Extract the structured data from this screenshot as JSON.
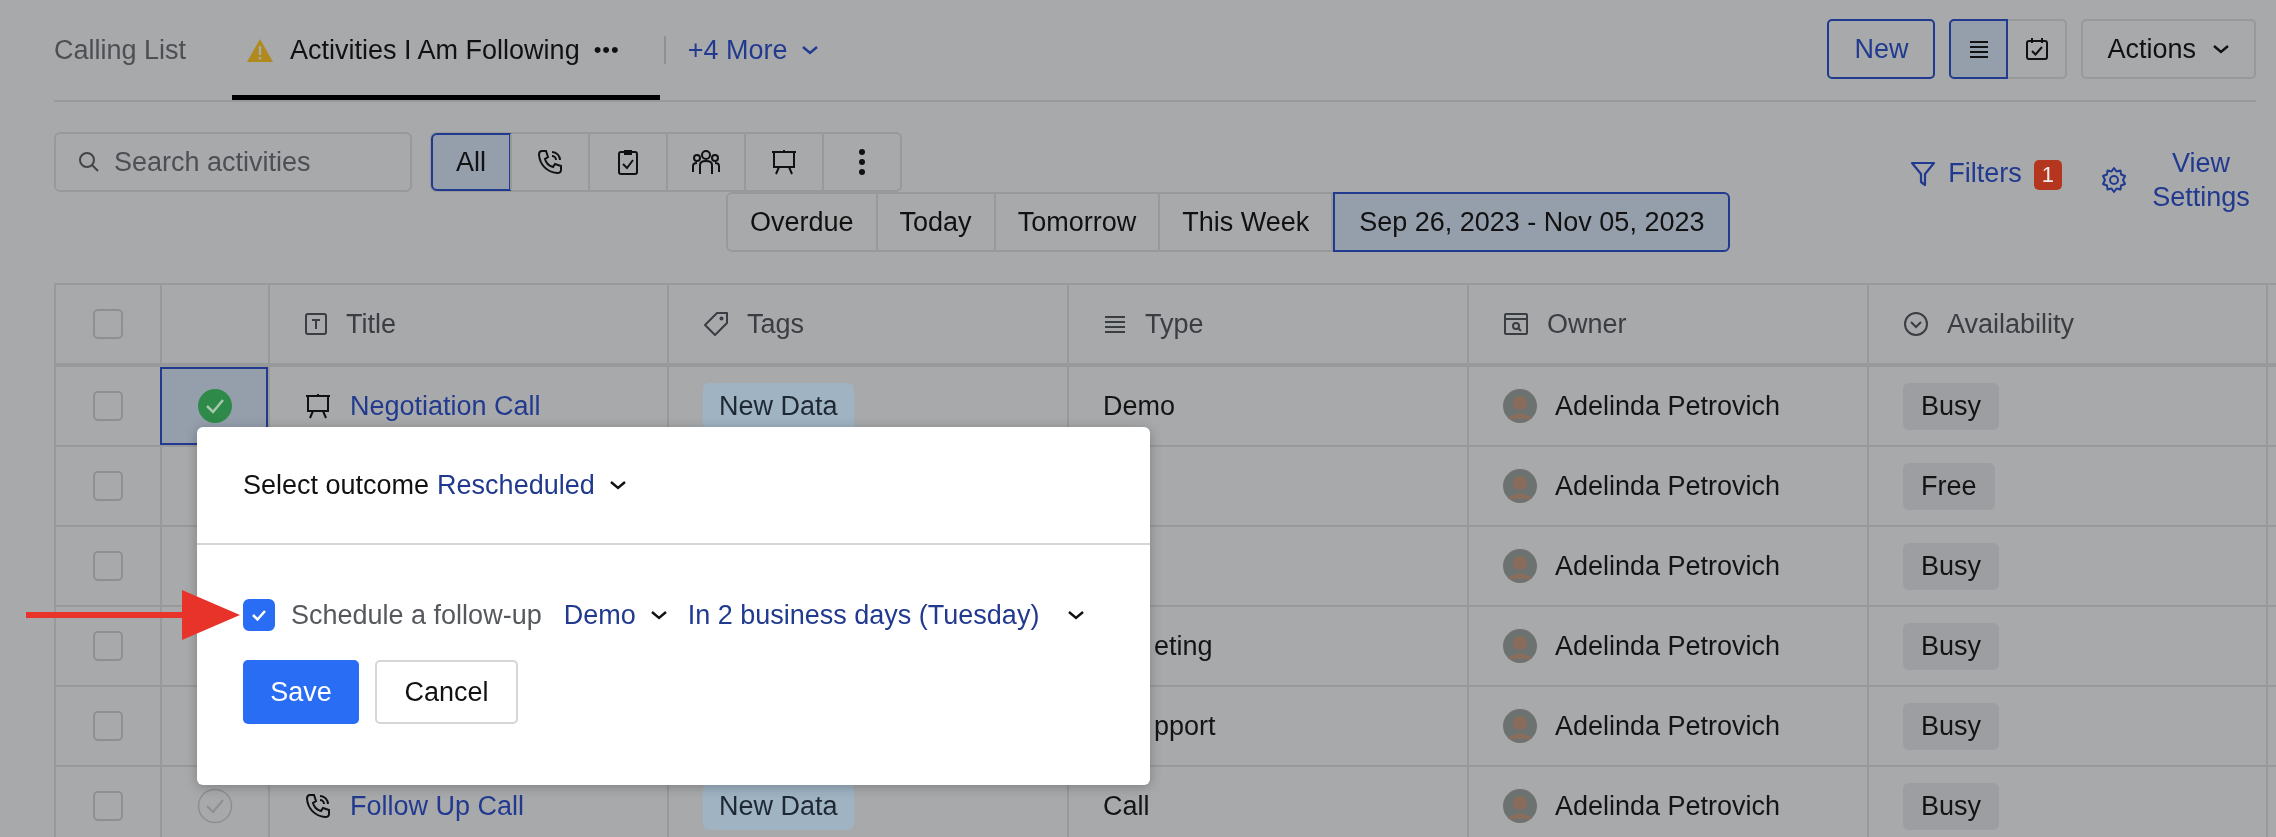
{
  "tabs": [
    {
      "label": "Calling List",
      "selected": false,
      "warning": false
    },
    {
      "label": "Activities I Am Following",
      "selected": true,
      "warning": true
    }
  ],
  "tab_menu": "•••",
  "more_tabs": "+4 More",
  "new_button": "New",
  "views": [
    {
      "kind": "list",
      "selected": true
    },
    {
      "kind": "calendar",
      "selected": false
    }
  ],
  "actions_button": "Actions",
  "search": {
    "placeholder": "Search activities"
  },
  "type_filters": [
    {
      "kind": "all",
      "label": "All",
      "selected": true
    },
    {
      "kind": "call",
      "selected": false
    },
    {
      "kind": "task",
      "selected": false
    },
    {
      "kind": "meeting",
      "selected": false
    },
    {
      "kind": "demo",
      "selected": false
    },
    {
      "kind": "more",
      "selected": false
    }
  ],
  "date_filters": [
    {
      "label": "Overdue",
      "selected": false
    },
    {
      "label": "Today",
      "selected": false
    },
    {
      "label": "Tomorrow",
      "selected": false
    },
    {
      "label": "This Week",
      "selected": false
    },
    {
      "label": "Sep 26, 2023 - Nov 05, 2023",
      "selected": true
    }
  ],
  "filters": {
    "label": "Filters",
    "count": "1"
  },
  "view_settings": "View Settings",
  "table": {
    "header_checked": false,
    "columns": [
      {
        "kind": "text",
        "label": "Title"
      },
      {
        "kind": "tag",
        "label": "Tags"
      },
      {
        "kind": "list",
        "label": "Type"
      },
      {
        "kind": "owner",
        "label": "Owner"
      },
      {
        "kind": "select",
        "label": "Availability"
      }
    ],
    "rows": [
      {
        "kind": "demo",
        "checked": false,
        "completed": true,
        "title": "Negotiation Call",
        "tag": "New Data",
        "type": "Demo",
        "owner": "Adelinda Petrovich",
        "availability": "Busy"
      },
      {
        "kind": "covered",
        "checked": false,
        "owner": "Adelinda Petrovich",
        "availability": "Free"
      },
      {
        "kind": "covered",
        "checked": false,
        "owner": "Adelinda Petrovich",
        "availability": "Busy"
      },
      {
        "kind": "covered",
        "checked": false,
        "type": "eting",
        "owner": "Adelinda Petrovich",
        "availability": "Busy"
      },
      {
        "kind": "covered",
        "checked": false,
        "type": "pport",
        "owner": "Adelinda Petrovich",
        "availability": "Busy"
      },
      {
        "kind": "call",
        "checked": false,
        "completed": false,
        "title": "Follow Up Call",
        "tag": "New Data",
        "type": "Call",
        "owner": "Adelinda Petrovich",
        "availability": "Busy"
      }
    ]
  },
  "popup": {
    "outcome_label": "Select outcome",
    "outcome_value": "Rescheduled",
    "follow_up": {
      "checked": true,
      "label": "Schedule a follow-up",
      "type": "Demo",
      "when": "In 2 business days (Tuesday)"
    },
    "save": "Save",
    "cancel": "Cancel"
  }
}
